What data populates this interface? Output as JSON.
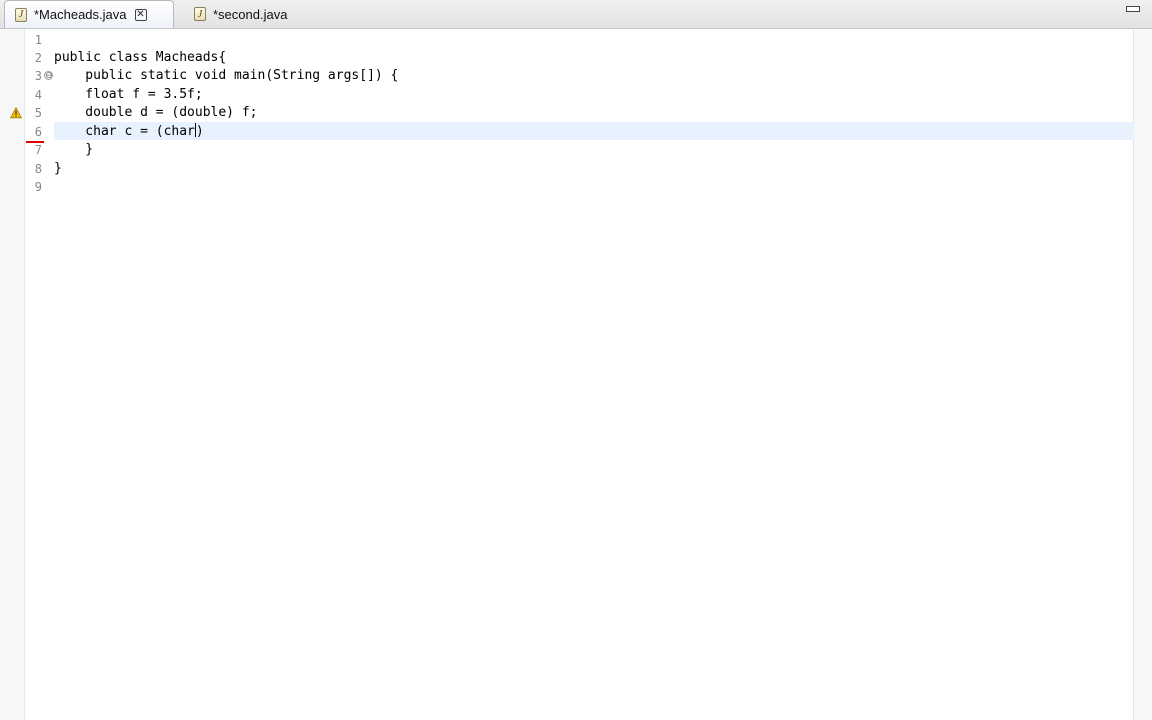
{
  "tabs": [
    {
      "label": "*Macheads.java",
      "active": true,
      "icon": "java-file-icon"
    },
    {
      "label": "*second.java",
      "active": false,
      "icon": "java-file-icon"
    }
  ],
  "editor": {
    "line_numbers": [
      "1",
      "2",
      "3",
      "4",
      "5",
      "6",
      "7",
      "8",
      "9"
    ],
    "lines": [
      "",
      "public class Macheads{",
      "    public static void main(String args[]) {",
      "    float f = 3.5f;",
      "    double d = (double) f;",
      "    char c = (char",
      "    }",
      "}",
      ""
    ],
    "caret_after": ")",
    "warning_line": "5",
    "fold_line": "3"
  },
  "colors": {
    "current_line": "#e8f2fe",
    "warning": "#f2c200",
    "error": "#d00000"
  }
}
